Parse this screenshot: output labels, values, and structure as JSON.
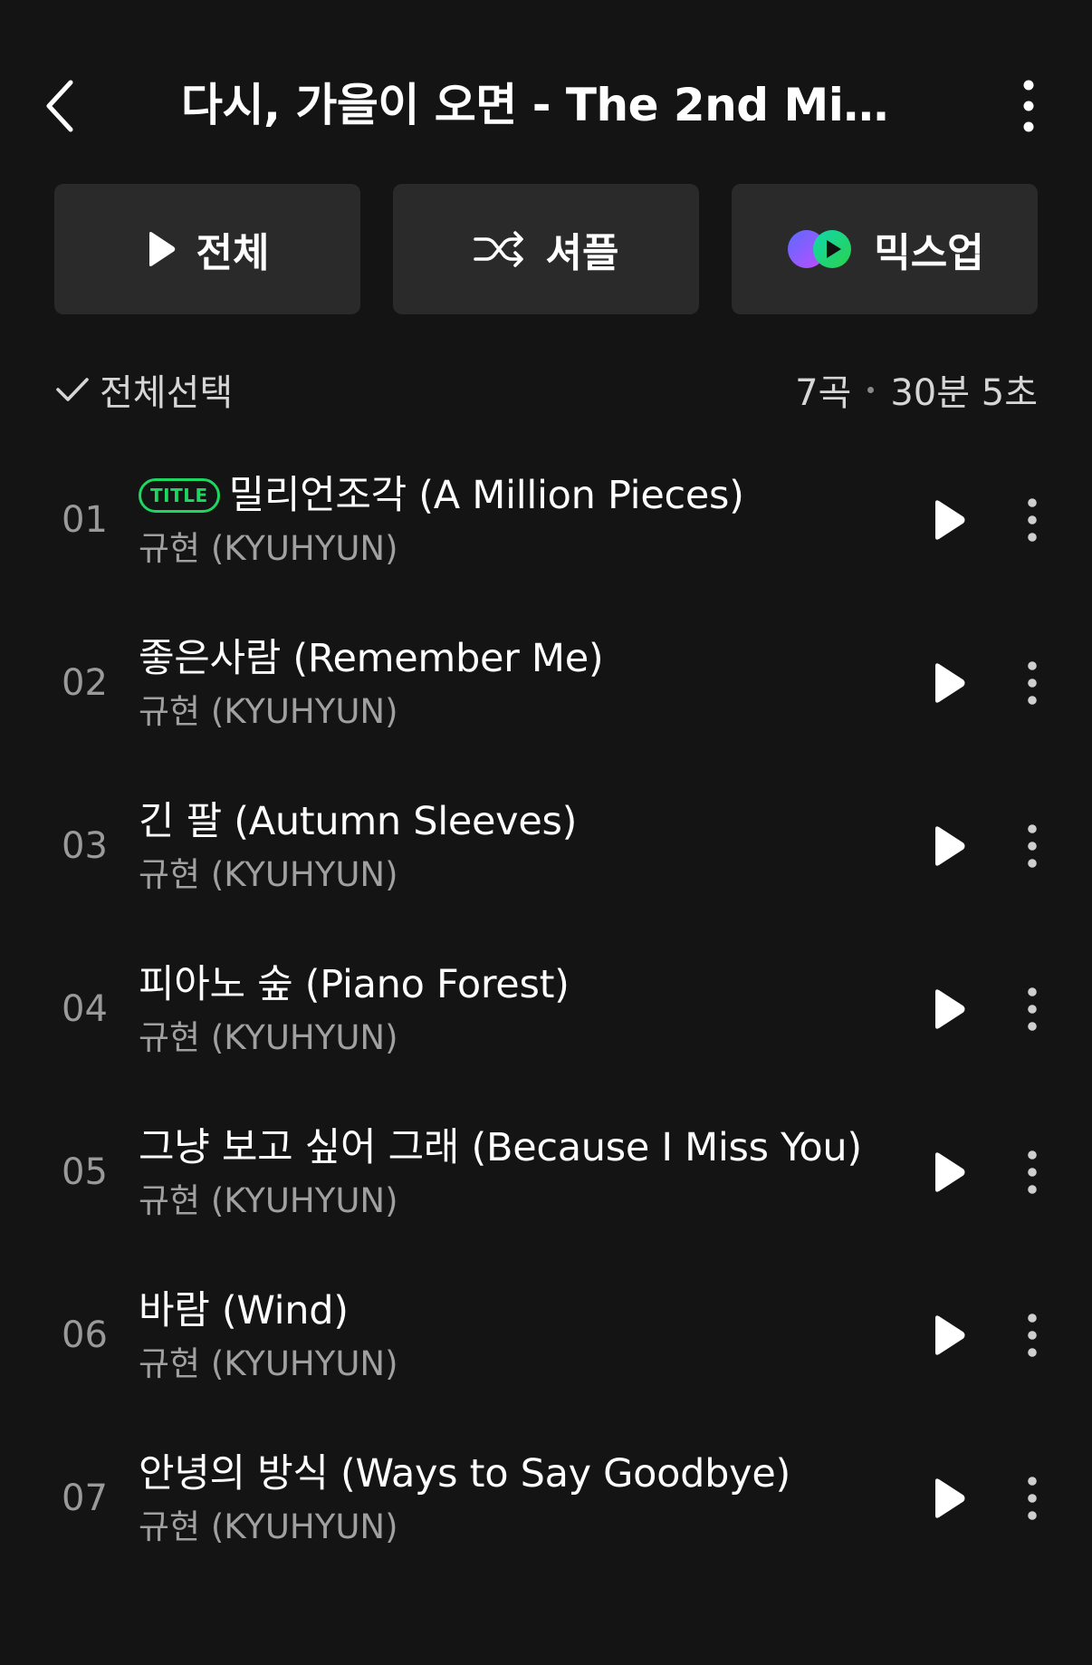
{
  "header": {
    "title": "다시, 가을이 오면 - The 2nd Mini...",
    "back_icon": "chevron-left-icon",
    "more_icon": "vertical-dots-icon"
  },
  "actions": {
    "play_all_label": "전체",
    "shuffle_label": "셔플",
    "mixup_label": "믹스업"
  },
  "selection": {
    "select_all_label": "전체선택",
    "track_count": "7곡",
    "total_duration": "30분 5초"
  },
  "colors": {
    "background": "#141414",
    "button_bg": "#2a2a2a",
    "accent_green": "#1ed760",
    "mixup_purple": "#7b4dff"
  },
  "tracks": [
    {
      "number": "01",
      "badge": "TITLE",
      "title": "밀리언조각 (A Million Pieces)",
      "artist": "규현 (KYUHYUN)"
    },
    {
      "number": "02",
      "badge": "",
      "title": "좋은사람 (Remember Me)",
      "artist": "규현 (KYUHYUN)"
    },
    {
      "number": "03",
      "badge": "",
      "title": "긴 팔 (Autumn Sleeves)",
      "artist": "규현 (KYUHYUN)"
    },
    {
      "number": "04",
      "badge": "",
      "title": "피아노 숲 (Piano Forest)",
      "artist": "규현 (KYUHYUN)"
    },
    {
      "number": "05",
      "badge": "",
      "title": "그냥 보고 싶어 그래 (Because I Miss You)",
      "artist": "규현 (KYUHYUN)"
    },
    {
      "number": "06",
      "badge": "",
      "title": "바람 (Wind)",
      "artist": "규현 (KYUHYUN)"
    },
    {
      "number": "07",
      "badge": "",
      "title": "안녕의 방식 (Ways to Say Goodbye)",
      "artist": "규현 (KYUHYUN)"
    }
  ]
}
